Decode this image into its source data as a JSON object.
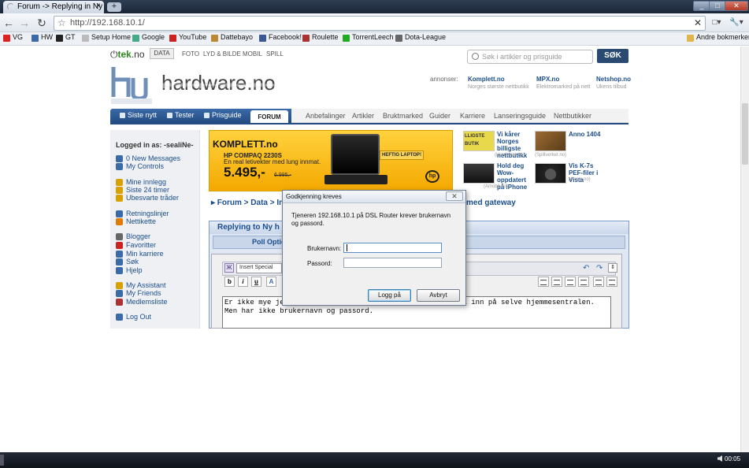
{
  "browser": {
    "tab_title": "Forum -> Replying in Ny ...",
    "tab_close": "×",
    "new_tab": "+",
    "url": "http://192.168.10.1/",
    "url_clear": "✕",
    "back": "←",
    "forward": "→",
    "reload": "↻",
    "home": "⌂",
    "window_min": "_",
    "window_max": "□",
    "window_close": "✕",
    "page_menu": "□▾",
    "tools_menu": "🔧▾",
    "bookmarks": [
      {
        "label": "VG",
        "color": "#d22"
      },
      {
        "label": "HW",
        "color": "#3a6aa8"
      },
      {
        "label": "GT",
        "color": "#222"
      },
      {
        "label": "Setup Home",
        "color": "#bbb"
      },
      {
        "label": "Google",
        "color": "#4a8"
      },
      {
        "label": "YouTube",
        "color": "#c22"
      },
      {
        "label": "Dattebayo",
        "color": "#b83"
      },
      {
        "label": "Facebook!",
        "color": "#3b5998"
      },
      {
        "label": "Roulette",
        "color": "#a33"
      },
      {
        "label": "TorrentLeech",
        "color": "#2a2"
      },
      {
        "label": "Dota-League",
        "color": "#666"
      }
    ],
    "other_bookmarks": "Andre bokmerker"
  },
  "site": {
    "tek_logo": "tek",
    "tek_suffix": ".no",
    "topnav": [
      "DATA",
      "FOTO",
      "LYD & BILDE",
      "MOBIL",
      "SPILL"
    ],
    "search_placeholder": "Søk i artikler og prisguide",
    "search_button": "SØK",
    "brand": "hardware.no",
    "ads_label": "annonser:",
    "ads": [
      {
        "name": "Komplett.no",
        "sub": "Norges største nettbutikk"
      },
      {
        "name": "MPX.no",
        "sub": "Elektromarked på nett"
      },
      {
        "name": "Netshop.no",
        "sub": "Ukens tilbud"
      }
    ],
    "mainnav": [
      "Siste nytt",
      "Tester",
      "Prisguide"
    ],
    "forum_tab": "FORUM",
    "subnav": [
      "Anbefalinger",
      "Artikler",
      "Bruktmarked",
      "Guider",
      "Karriere",
      "Lanseringsguide",
      "Nettbutikker"
    ]
  },
  "sidebar": {
    "logged_in": "Logged in as: -sealiNe-",
    "items": [
      {
        "label": "0 New Messages",
        "color": "#3a6aa8"
      },
      {
        "label": "My Controls",
        "color": "#3a6aa8"
      },
      {
        "label": "Mine innlegg",
        "color": "#d8a000"
      },
      {
        "label": "Siste 24 timer",
        "color": "#d8a000"
      },
      {
        "label": "Ubesvarte tråder",
        "color": "#d8a000"
      },
      {
        "label": "Retningslinjer",
        "color": "#3a6aa8"
      },
      {
        "label": "Nettikette",
        "color": "#e07b00"
      },
      {
        "label": "Blogger",
        "color": "#666"
      },
      {
        "label": "Favoritter",
        "color": "#c22"
      },
      {
        "label": "Min karriere",
        "color": "#3a6aa8"
      },
      {
        "label": "Søk",
        "color": "#3a6aa8"
      },
      {
        "label": "Hjelp",
        "color": "#3a6aa8"
      },
      {
        "label": "My Assistant",
        "color": "#d8a000"
      },
      {
        "label": "My Friends",
        "color": "#3a6aa8"
      },
      {
        "label": "Medlemsliste",
        "color": "#a33"
      },
      {
        "label": "Log Out",
        "color": "#3a6aa8"
      }
    ]
  },
  "banner": {
    "logo": "KOMPLETT.no",
    "model": "HP COMPAQ 2230S",
    "desc": "En real letivekter med lung innmat.",
    "price": "5.495,-",
    "old_price": "6.995,-",
    "tag": "HEFTIG LAPTOP!",
    "hp": "hp"
  },
  "news": [
    {
      "title": "Vi kårer Norges billigste nettbutikk",
      "src": "(Hardware.no)"
    },
    {
      "title": "Anno 1404",
      "src": "(Spillverket.no)"
    },
    {
      "title": "Hold deg Wow-oppdatert på iPhone",
      "src": "(Amobil.no)"
    },
    {
      "title": "Vis K-7s PEF-filer i Vista",
      "src": "(Akam.no)"
    }
  ],
  "thumb_text": "LLIGSTE BUTIK",
  "breadcrumb": {
    "left": "▸ Forum > Data > Inf",
    "right": "med gateway"
  },
  "reply": {
    "title": "Replying to Ny h",
    "poll": "Poll Optio",
    "font_select": "Insert Special",
    "fmt": [
      "b",
      "i",
      "u"
    ],
    "text_lines": [
      "Er ikke mye je                                          l inn på selve hjemmesentralen.",
      "Men har ikke brukernavn og passord."
    ]
  },
  "dialog": {
    "title": "Godkjenning kreves",
    "close": "✕",
    "message": "Tjeneren 192.168.10.1 på DSL Router krever brukernavn og passord.",
    "username_label": "Brukernavn:",
    "password_label": "Passord:",
    "username_value": "",
    "password_value": "",
    "ok": "Logg på",
    "cancel": "Avbryt"
  },
  "taskbar": {
    "clock": "00:05"
  }
}
